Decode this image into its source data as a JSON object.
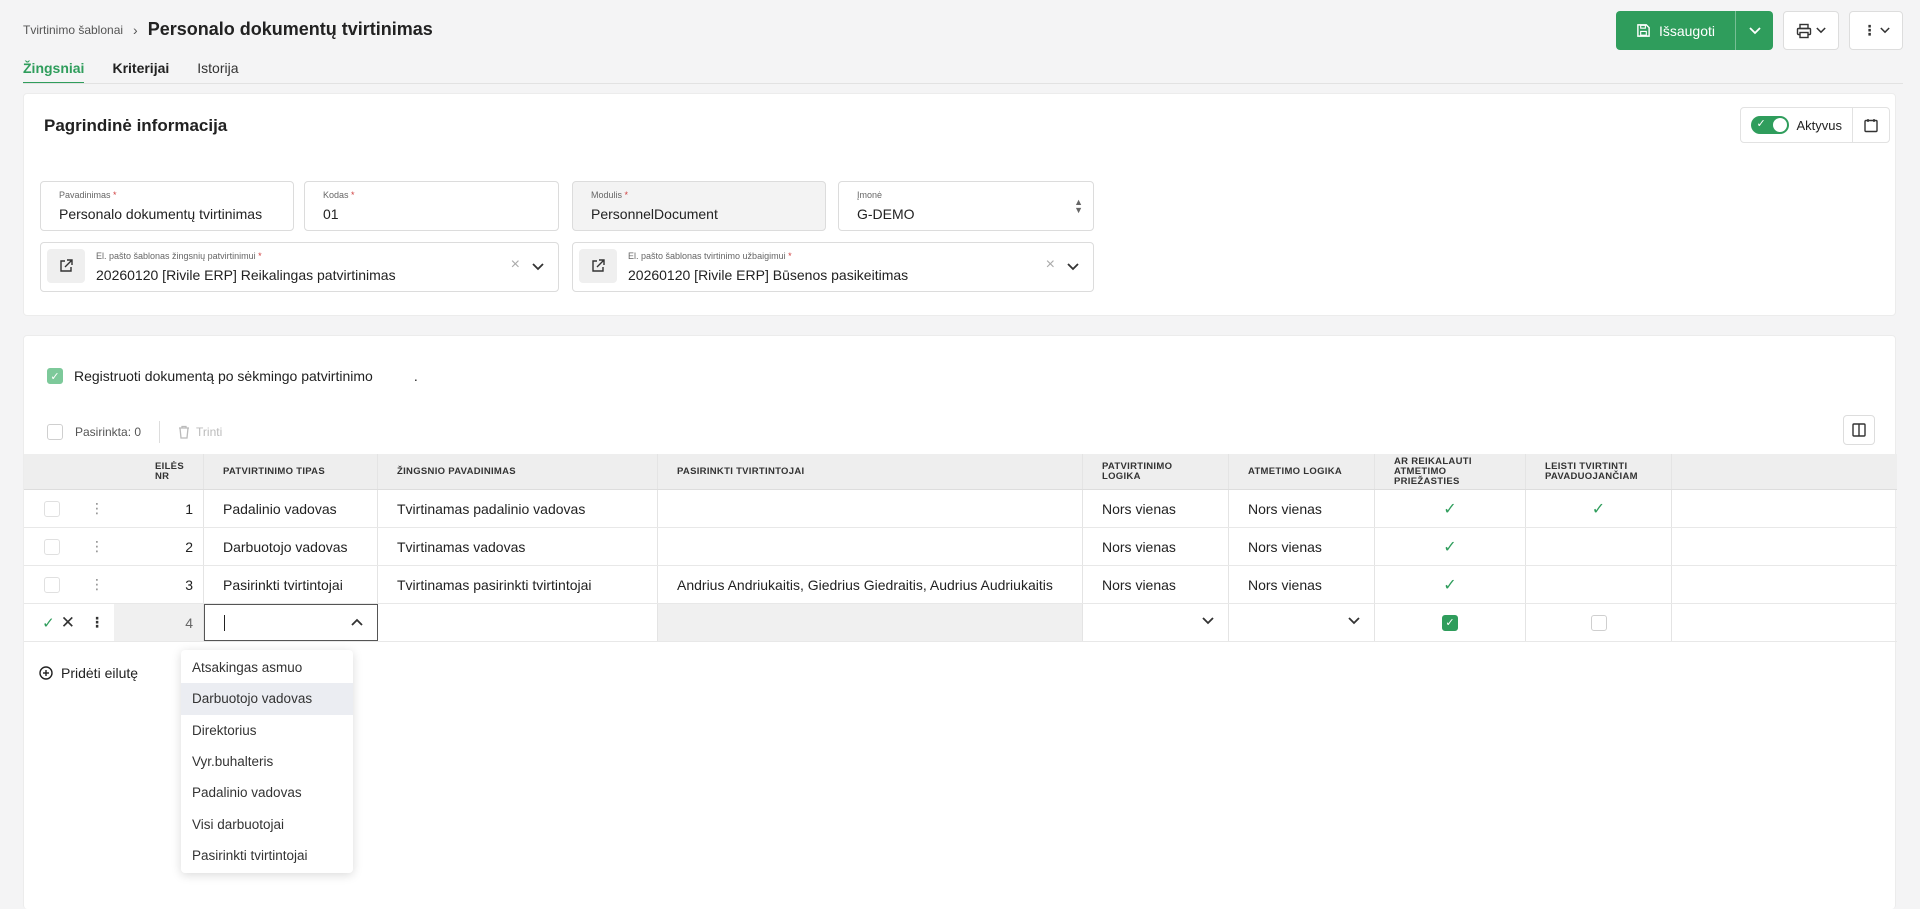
{
  "header": {
    "breadcrumb_link": "Tvirtinimo šablonai",
    "breadcrumb_sep": "›",
    "title": "Personalo dokumentų tvirtinimas",
    "save_label": "Išsaugoti"
  },
  "tabs": [
    {
      "label": "Žingsniai"
    },
    {
      "label": "Kriterijai"
    },
    {
      "label": "Istorija"
    }
  ],
  "main_info": {
    "title": "Pagrindinė informacija",
    "active_label": "Aktyvus",
    "fields": {
      "name": {
        "label": "Pavadinimas",
        "value": "Personalo dokumentų tvirtinimas"
      },
      "code": {
        "label": "Kodas",
        "value": "01"
      },
      "module": {
        "label": "Modulis",
        "value": "PersonnelDocument"
      },
      "company": {
        "label": "Įmonė",
        "value": "G-DEMO"
      },
      "email_step": {
        "label": "El. pašto šablonas žingsnių patvirtinimui",
        "value": "20260120 [Rivile ERP] Reikalingas patvirtinimas"
      },
      "email_finish": {
        "label": "El. pašto šablonas tvirtinimo užbaigimui",
        "value": "20260120 [Rivile ERP] Būsenos pasikeitimas"
      }
    },
    "required_mark": "*"
  },
  "steps": {
    "register_label": "Registruoti dokumentą po sėkmingo patvirtinimo",
    "register_suffix": ".",
    "selected_label": "Pasirinkta: 0",
    "delete_label": "Trinti",
    "columns": {
      "nr": "EILĖS NR",
      "type": "PATVIRTINIMO TIPAS",
      "name": "ŽINGSNIO PAVADINIMAS",
      "approvers": "PASIRINKTI TVIRTINTOJAI",
      "approve_logic": "PATVIRTINIMO LOGIKA",
      "reject_logic": "ATMETIMO LOGIKA",
      "require_reason": "AR REIKALAUTI ATMETIMO PRIEŽASTIES",
      "allow_substitute": "LEISTI TVIRTINTI PAVADUOJANČIAM"
    },
    "rows": [
      {
        "nr": "1",
        "type": "Padalinio vadovas",
        "name": "Tvirtinamas padalinio vadovas",
        "approvers": "",
        "approve_logic": "Nors vienas",
        "reject_logic": "Nors vienas",
        "require_reason": true,
        "allow_substitute": true
      },
      {
        "nr": "2",
        "type": "Darbuotojo vadovas",
        "name": "Tvirtinamas vadovas",
        "approvers": "",
        "approve_logic": "Nors vienas",
        "reject_logic": "Nors vienas",
        "require_reason": true,
        "allow_substitute": false
      },
      {
        "nr": "3",
        "type": "Pasirinkti tvirtintojai",
        "name": "Tvirtinamas pasirinkti tvirtintojai",
        "approvers": "Andrius Andriukaitis, Giedrius Giedraitis, Audrius Audriukaitis",
        "approve_logic": "Nors vienas",
        "reject_logic": "Nors vienas",
        "require_reason": true,
        "allow_substitute": false
      }
    ],
    "edit_row": {
      "nr": "4",
      "require_reason": true,
      "allow_substitute": false
    },
    "add_row_label": "Pridėti eilutę"
  },
  "dropdown": {
    "options": [
      "Atsakingas asmuo",
      "Darbuotojo vadovas",
      "Direktorius",
      "Vyr.buhalteris",
      "Padalinio vadovas",
      "Visi darbuotojai",
      "Pasirinkti tvirtintojai"
    ],
    "highlighted": "Darbuotojo vadovas"
  },
  "colors": {
    "accent": "#2f9d5c"
  }
}
